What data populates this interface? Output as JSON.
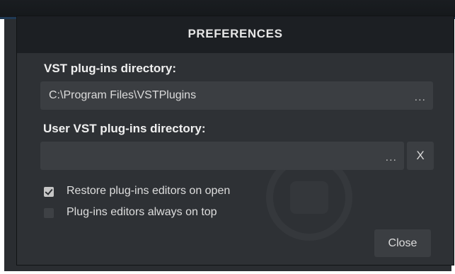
{
  "dialog": {
    "title": "PREFERENCES",
    "vst_directory": {
      "label": "VST plug-ins directory:",
      "value": "C:\\Program Files\\VSTPlugins",
      "browse_label": "..."
    },
    "user_vst_directory": {
      "label": "User VST plug-ins directory:",
      "value": "",
      "browse_label": "...",
      "clear_label": "X"
    },
    "options": [
      {
        "label": "Restore plug-ins editors on open",
        "checked": true
      },
      {
        "label": "Plug-ins editors always on top",
        "checked": false
      }
    ],
    "close_label": "Close"
  },
  "colors": {
    "dialog_background": "#2e3135",
    "header_background": "#1c1f23",
    "field_background": "#3b3e42",
    "text": "#f0f0f0"
  }
}
